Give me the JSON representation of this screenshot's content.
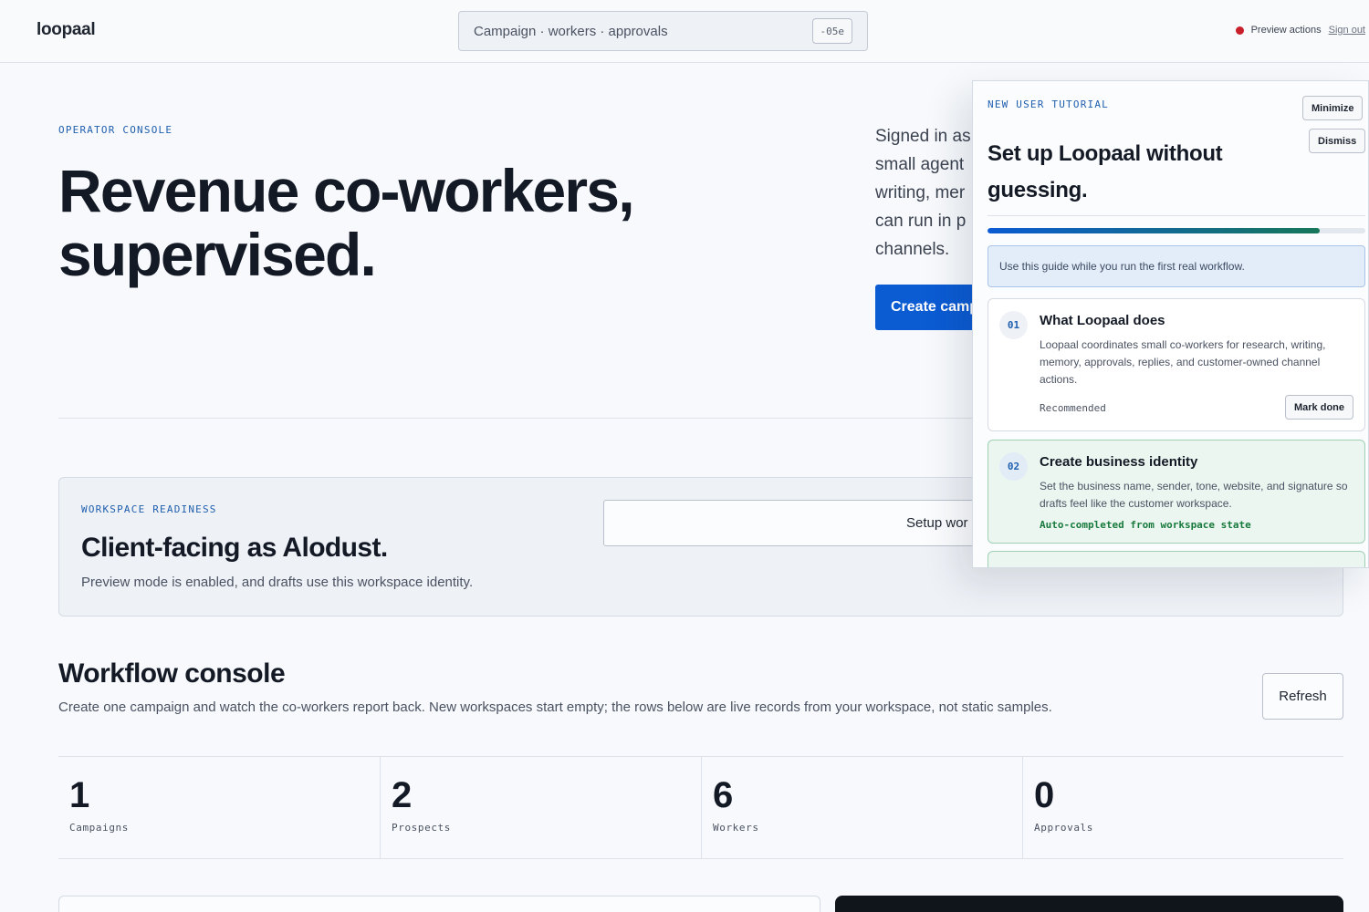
{
  "header": {
    "brand": "loopaal",
    "search_text": "Campaign · workers · approvals",
    "search_shortcut": "-05e",
    "preview_actions": "Preview actions",
    "sign_out": "Sign out"
  },
  "hero": {
    "eyebrow": "OPERATOR CONSOLE",
    "title": "Revenue co-workers, supervised.",
    "desc_lines": [
      "Signed in as",
      "small agent",
      "writing, mer",
      "can run in p",
      "channels."
    ],
    "create_button": "Create camp"
  },
  "readiness": {
    "eyebrow": "WORKSPACE READINESS",
    "title": "Client-facing as Alodust.",
    "desc": "Preview mode is enabled, and drafts use this workspace identity.",
    "setup_button": "Setup wor"
  },
  "workflow": {
    "title": "Workflow console",
    "desc": "Create one campaign and watch the co-workers report back. New workspaces start empty; the rows below are live records from your workspace, not static samples.",
    "refresh_button": "Refresh",
    "stats": [
      {
        "value": "1",
        "label": "Campaigns"
      },
      {
        "value": "2",
        "label": "Prospects"
      },
      {
        "value": "6",
        "label": "Workers"
      },
      {
        "value": "0",
        "label": "Approvals"
      }
    ]
  },
  "tutorial": {
    "eyebrow": "NEW USER TUTORIAL",
    "title": "Set up Loopaal without guessing.",
    "minimize": "Minimize",
    "dismiss": "Dismiss",
    "progress": 0.88,
    "guide_note": "Use this guide while you run the first real workflow.",
    "steps": [
      {
        "num": "01",
        "title": "What Loopaal does",
        "desc": "Loopaal coordinates small co-workers for research, writing, memory, approvals, replies, and customer-owned channel actions.",
        "meta": "Recommended",
        "action": "Mark done"
      },
      {
        "num": "02",
        "title": "Create business identity",
        "desc": "Set the business name, sender, tone, website, and signature so drafts feel like the customer workspace.",
        "meta": "Auto-completed from workspace state"
      }
    ]
  },
  "colors": {
    "accent": "#0b5bd3",
    "status_dot": "#c81f2b",
    "success": "#177a3c"
  }
}
